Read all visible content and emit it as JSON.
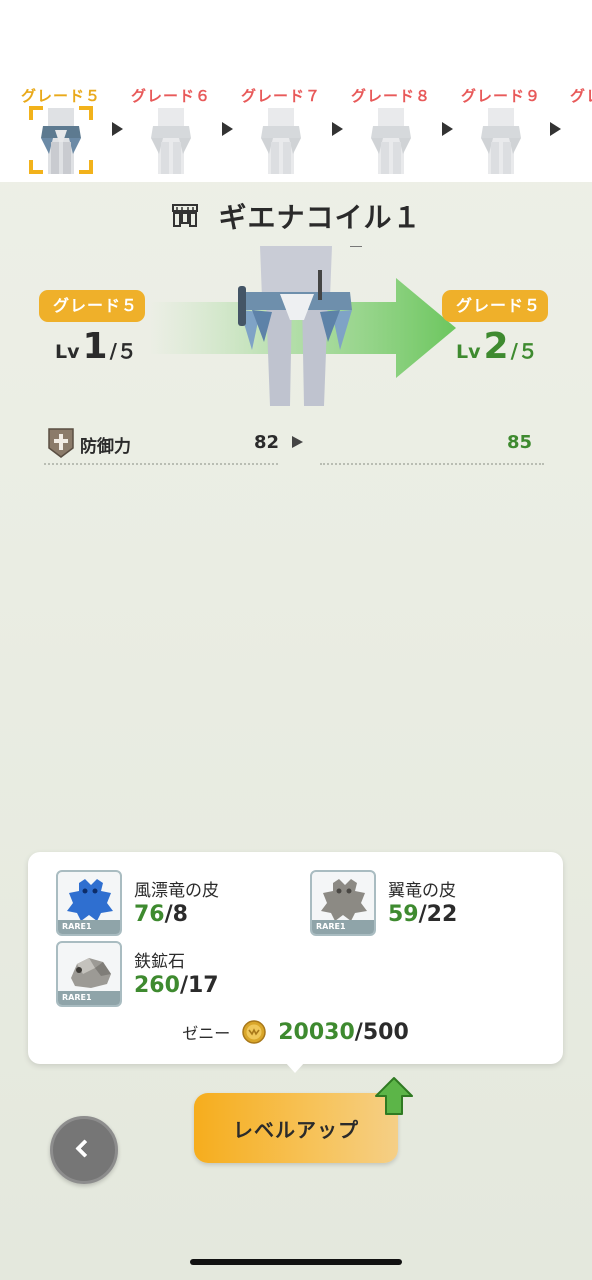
{
  "grade_strip": {
    "items": [
      {
        "label": "グレード５",
        "current": true
      },
      {
        "label": "グレード６",
        "current": false
      },
      {
        "label": "グレード７",
        "current": false
      },
      {
        "label": "グレード８",
        "current": false
      },
      {
        "label": "グレード９",
        "current": false
      },
      {
        "label": "グレ",
        "current": false
      }
    ]
  },
  "equipment": {
    "name": "ギエナコイル１",
    "type_icon": "waist-armor-icon"
  },
  "upgrade": {
    "from": {
      "grade": "グレード５",
      "lv_prefix": "Lv",
      "lv": "1",
      "lv_max": "/５"
    },
    "to": {
      "grade": "グレード５",
      "lv_prefix": "Lv",
      "lv": "2",
      "lv_max": "/５"
    }
  },
  "stat": {
    "name": "防御力",
    "icon": "defense-shield-icon",
    "old": "82",
    "new": "85"
  },
  "materials": {
    "items": [
      {
        "name": "風漂竜の皮",
        "have": "76",
        "need": "/8",
        "rarity": "RARE1",
        "icon": "blue-hide-icon"
      },
      {
        "name": "翼竜の皮",
        "have": "59",
        "need": "/22",
        "rarity": "RARE1",
        "icon": "gray-hide-icon"
      },
      {
        "name": "鉄鉱石",
        "have": "260",
        "need": "/17",
        "rarity": "RARE1",
        "icon": "ore-icon"
      }
    ],
    "zenny": {
      "label": "ゼニー",
      "have": "20030",
      "need": "/500",
      "icon": "zenny-coin-icon"
    }
  },
  "actions": {
    "level_up_label": "レベルアップ",
    "back_icon": "back-chevron-icon"
  },
  "colors": {
    "accent": "#efb02a",
    "positive": "#3e8a2f",
    "locked_grade": "#e85a5a"
  }
}
